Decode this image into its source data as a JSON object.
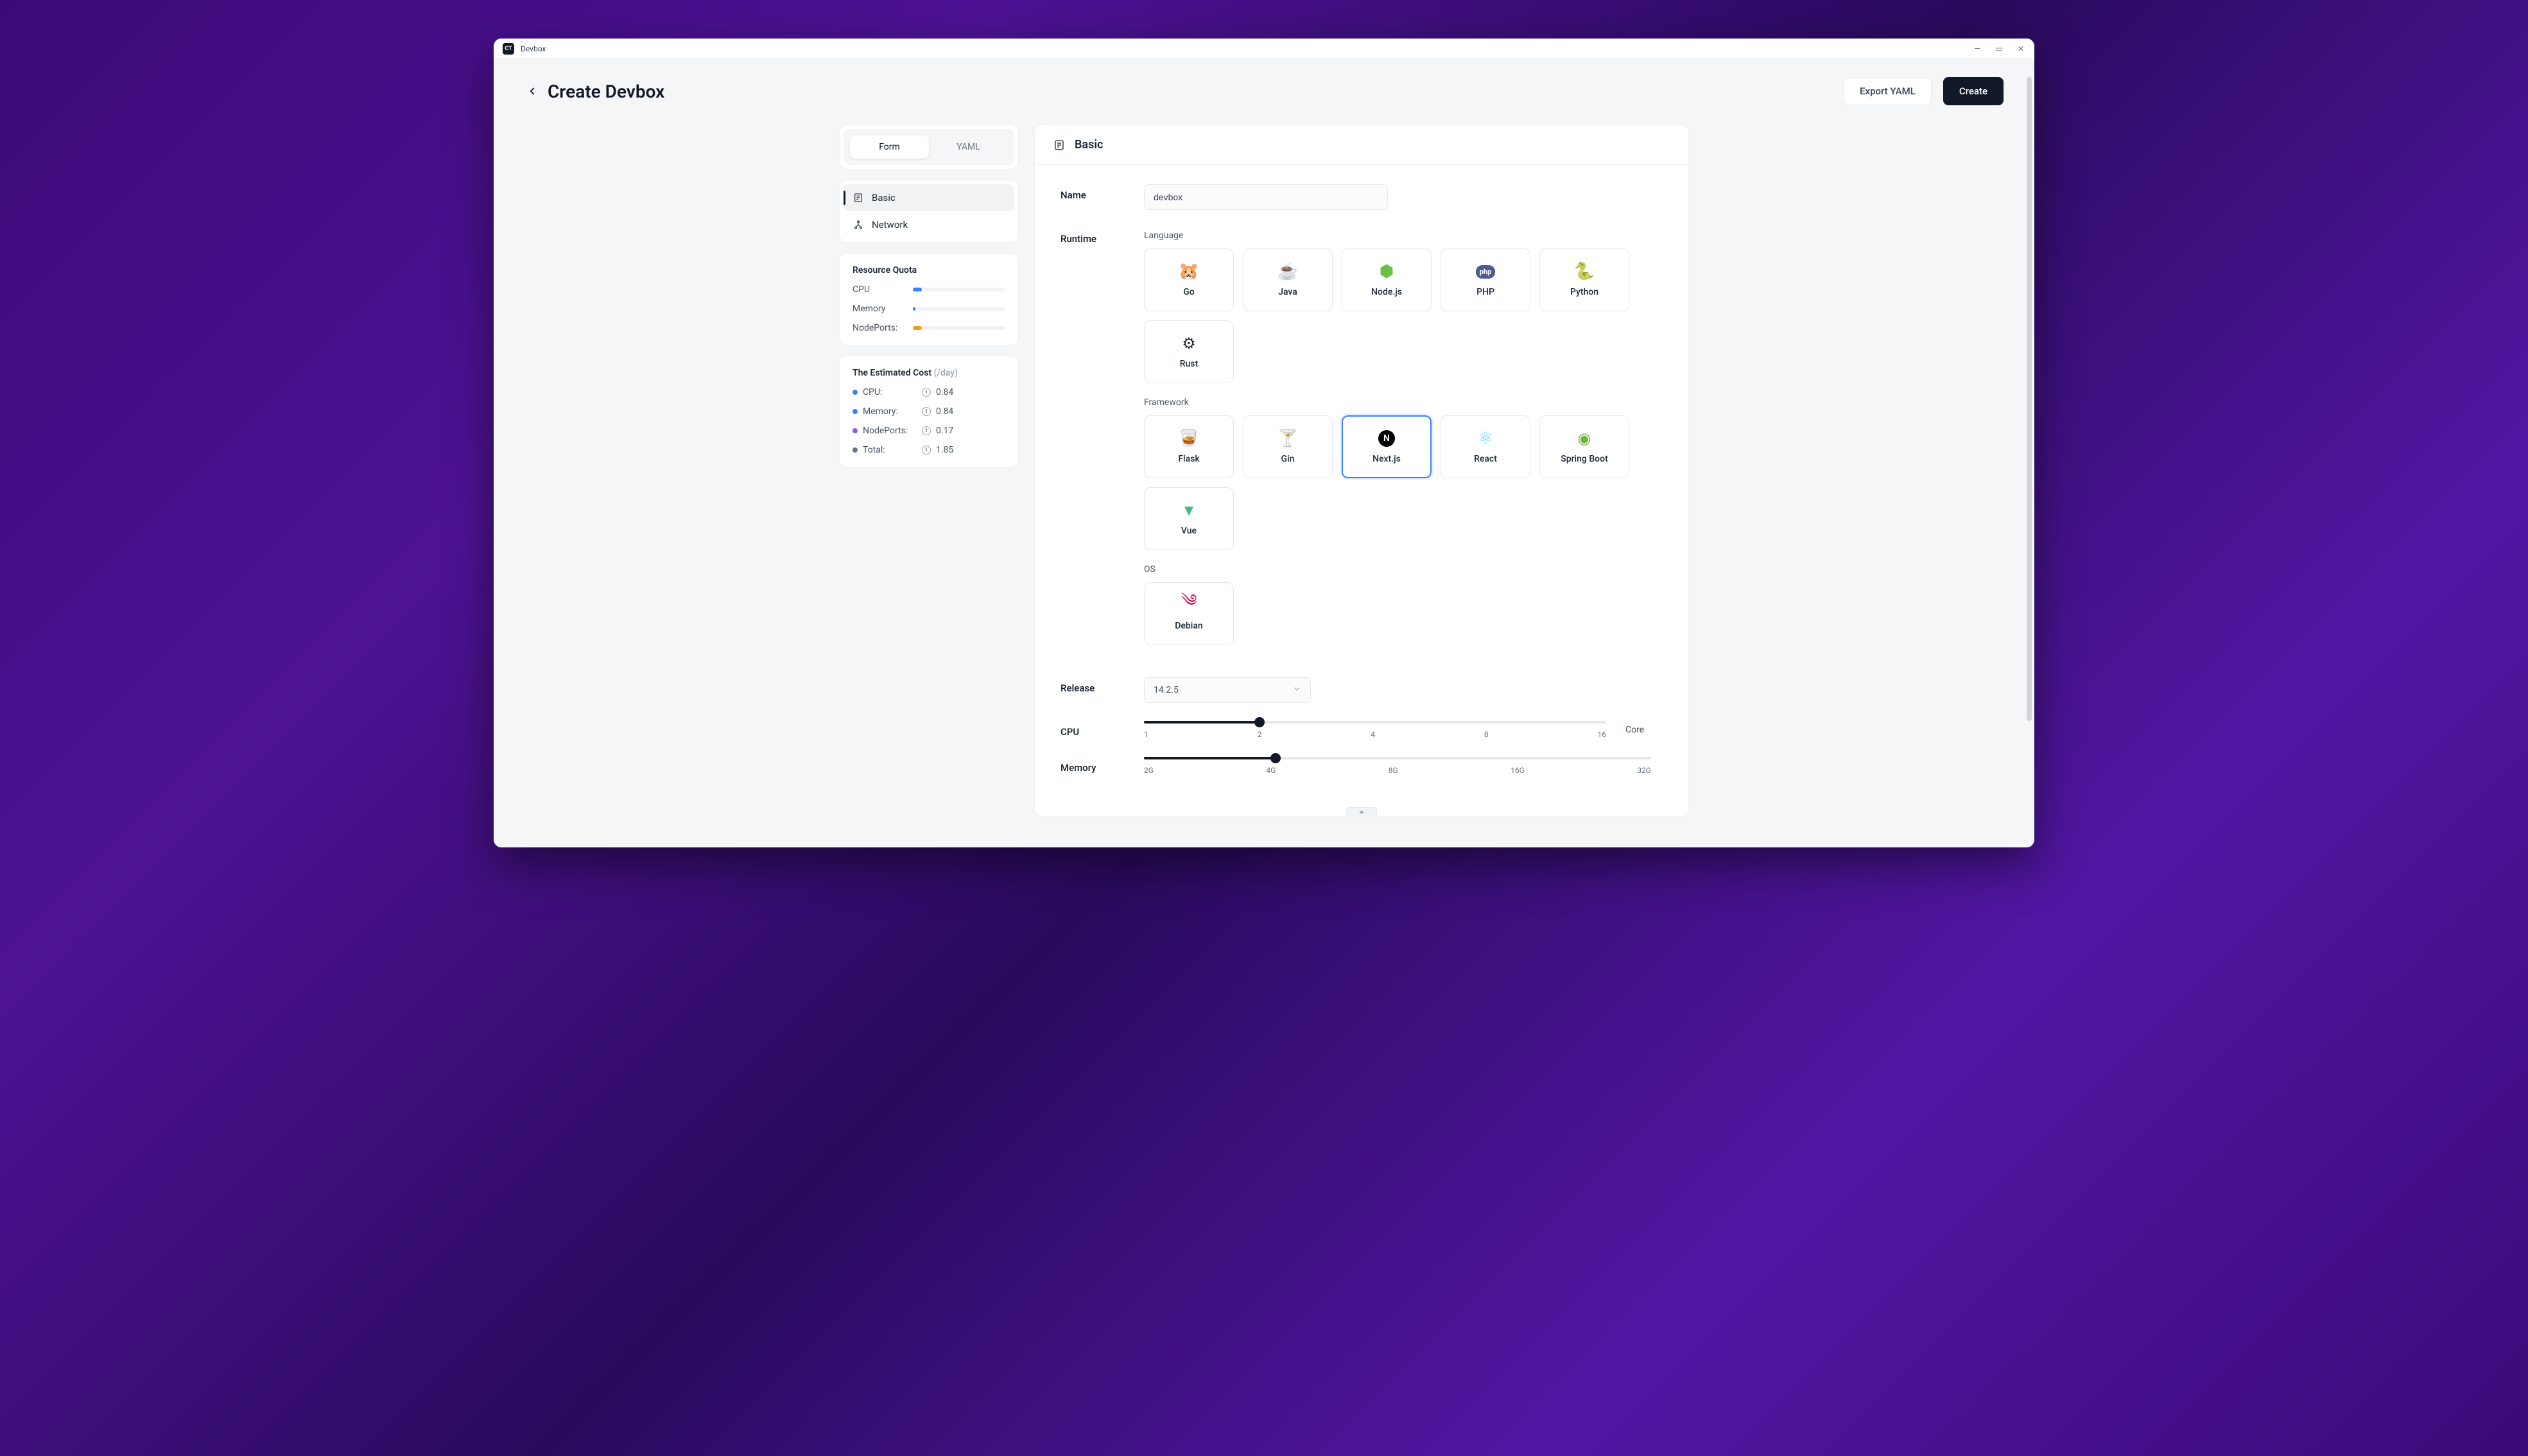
{
  "window": {
    "title": "Devbox"
  },
  "page": {
    "title": "Create Devbox",
    "actions": {
      "export": "Export YAML",
      "create": "Create"
    }
  },
  "tabs": {
    "form": "Form",
    "yaml": "YAML",
    "active": "form"
  },
  "nav": {
    "items": [
      {
        "key": "basic",
        "label": "Basic",
        "active": true
      },
      {
        "key": "network",
        "label": "Network",
        "active": false
      }
    ]
  },
  "resource_quota": {
    "title": "Resource Quota",
    "rows": [
      {
        "label": "CPU",
        "pct": 10,
        "color": "#3b82f6"
      },
      {
        "label": "Memory",
        "pct": 3,
        "color": "#3b82f6"
      },
      {
        "label": "NodePorts:",
        "pct": 10,
        "color": "#f59e0b"
      }
    ]
  },
  "estimated_cost": {
    "title": "The Estimated Cost",
    "suffix": "(/day)",
    "rows": [
      {
        "label": "CPU:",
        "value": "0.84",
        "dot": "#3b82f6"
      },
      {
        "label": "Memory:",
        "value": "0.84",
        "dot": "#3b82f6"
      },
      {
        "label": "NodePorts:",
        "value": "0.17",
        "dot": "#8b5cf6"
      },
      {
        "label": "Total:",
        "value": "1.85",
        "dot": "#6b7280"
      }
    ]
  },
  "panel": {
    "title": "Basic",
    "name": {
      "label": "Name",
      "value": "devbox"
    },
    "runtime": {
      "label": "Runtime",
      "language": {
        "label": "Language",
        "items": [
          "Go",
          "Java",
          "Node.js",
          "PHP",
          "Python",
          "Rust"
        ]
      },
      "framework": {
        "label": "Framework",
        "items": [
          "Flask",
          "Gin",
          "Next.js",
          "React",
          "Spring Boot",
          "Vue"
        ],
        "selected": "Next.js"
      },
      "os": {
        "label": "OS",
        "items": [
          "Debian"
        ]
      }
    },
    "release": {
      "label": "Release",
      "value": "14.2.5"
    },
    "cpu": {
      "label": "CPU",
      "unit": "Core",
      "ticks": [
        "1",
        "2",
        "4",
        "8",
        "16"
      ],
      "pos_pct": 25
    },
    "memory": {
      "label": "Memory",
      "ticks": [
        "2G",
        "4G",
        "8G",
        "16G",
        "32G"
      ],
      "pos_pct": 26
    }
  },
  "icons": {
    "language": {
      "Go": "🐹",
      "Java": "☕",
      "Node.js": "⬢",
      "PHP": "php",
      "Python": "🐍",
      "Rust": "⚙"
    },
    "framework": {
      "Flask": "🥃",
      "Gin": "🍸",
      "Next.js": "N",
      "React": "⚛",
      "Spring Boot": "🟢",
      "Vue": "▼"
    },
    "os": {
      "Debian": "🌀"
    }
  }
}
